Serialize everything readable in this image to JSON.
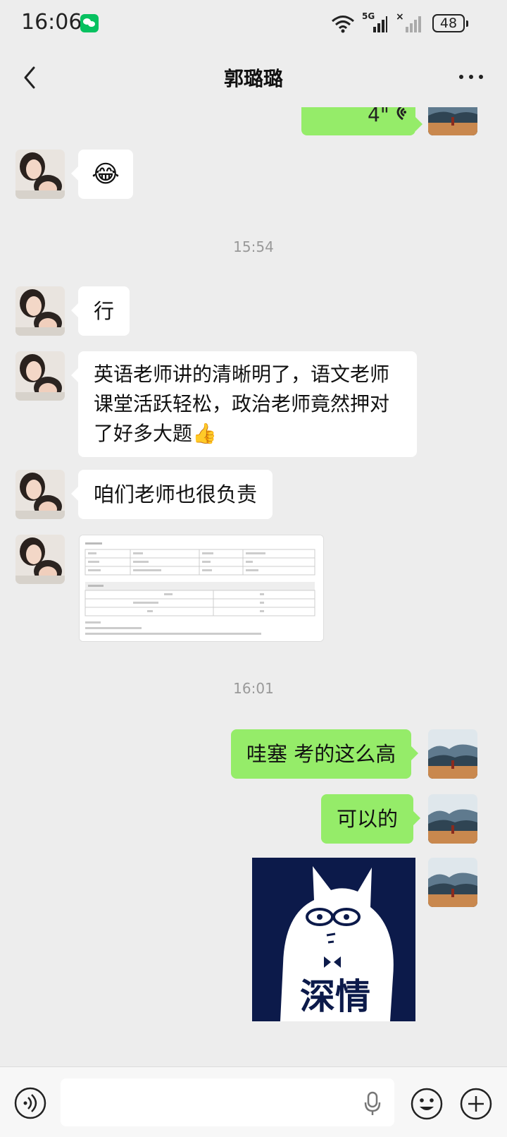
{
  "status_bar": {
    "time": "16:06",
    "network": "5G",
    "battery": "48"
  },
  "header": {
    "title": "郭璐璐"
  },
  "messages": {
    "m0_voice_duration": "4\"",
    "m1_emoji": "😂",
    "ts1": "15:54",
    "m2_text": "行",
    "m3_line1": "英语老师讲的清晰明了，语文老师",
    "m3_line2": "课堂活跃轻松，政治老师竟然押对",
    "m3_line3": "了好多大题👍",
    "m4_text": "咱们老师也很负责",
    "ts2": "16:01",
    "m6_text": "哇塞 考的这么高",
    "m7_text": "可以的",
    "m8_sticker_text": "深情"
  },
  "input": {
    "placeholder": ""
  },
  "icons": {
    "back": "back-arrow-icon",
    "more": "more-dots-icon",
    "voice": "voice-input-icon",
    "mic": "mic-icon",
    "emoji": "emoji-icon",
    "plus": "plus-icon"
  },
  "colors": {
    "background": "#ededed",
    "sent_bubble": "#95ec69",
    "received_bubble": "#ffffff",
    "wechat_green": "#07c160"
  }
}
